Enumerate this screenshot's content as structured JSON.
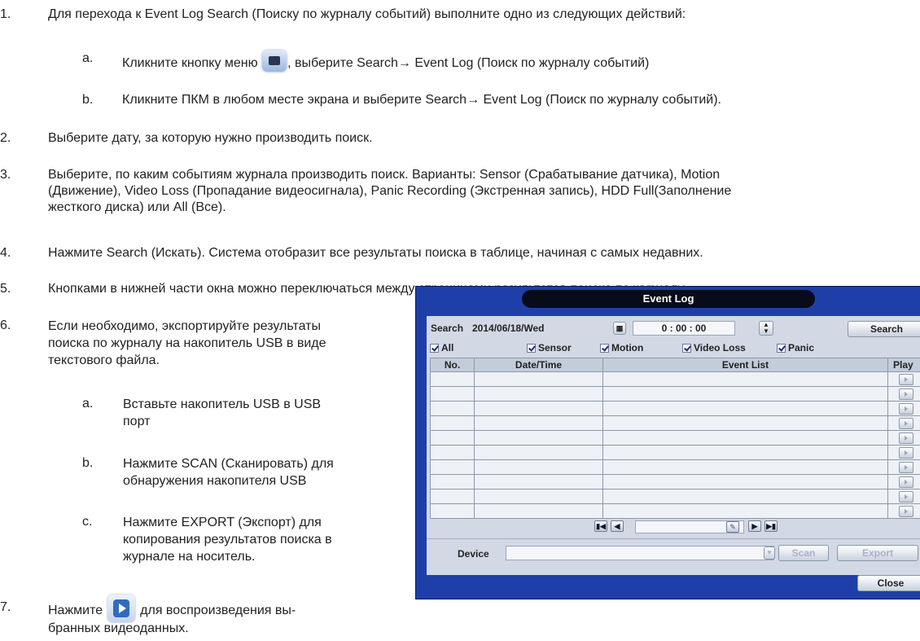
{
  "steps": [
    {
      "num": "1.",
      "text": "Для перехода к Event Log Search (Поиску по журналу событий) выполните одно из следующих действий:"
    },
    {
      "num": "2.",
      "text": "Выберите дату, за которую нужно производить поиск."
    },
    {
      "num": "3.",
      "lines": [
        "Выберите, по каким событиям журнала производить поиск. Варианты: Sensor (Срабатывание датчика), Motion",
        "(Движение), Video Loss (Пропадание видеосигнала), Panic Recording (Экстренная запись), HDD Full(Заполнение",
        "жесткого диска) или All (Все)."
      ]
    },
    {
      "num": "4.",
      "text": "Нажмите Search (Искать). Система отобразит все результаты поиска в таблице, начиная с самых недавних."
    },
    {
      "num": "5.",
      "text": "Кнопками в нижней части окна можно переключаться между страницами результатов поиска по журналу."
    },
    {
      "num": "6.",
      "lines": [
        "Если необходимо, экспортируйте результаты",
        "поиска по журналу на накопитель USB в виде",
        "текстового файла."
      ]
    },
    {
      "num": "7.",
      "before": "Нажмите",
      "after": "для воспроизведения вы-",
      "line2": "бранных видеоданных."
    }
  ],
  "substeps_1": [
    {
      "num": "a.",
      "before": "Кликните кнопку меню",
      "after": ", выберите Search→ Event Log (Поиск по журналу событий)"
    },
    {
      "num": "b.",
      "text": "Кликните ПКМ в любом месте экрана и выберите Search→ Event Log (Поиск по журналу событий)."
    }
  ],
  "substeps_6": [
    {
      "num": "a.",
      "lines": [
        "Вставьте накопитель USB в USB",
        "порт"
      ]
    },
    {
      "num": "b.",
      "lines": [
        "Нажмите SCAN (Сканировать) для",
        "обнаружения накопителя USB"
      ]
    },
    {
      "num": "c.",
      "lines": [
        "Нажмите EXPORT (Экспорт) для",
        "копирования результатов поиска в",
        "журнале на носитель."
      ]
    }
  ],
  "icons": {
    "menu": "menu-button-icon",
    "play": "play-button-icon"
  },
  "dialog": {
    "title": "Event Log",
    "search_label": "Search",
    "date": "2014/06/18/Wed",
    "time": "0 : 00 : 00",
    "search_button": "Search",
    "checkboxes": [
      "All",
      "Sensor",
      "Motion",
      "Video Loss",
      "Panic"
    ],
    "columns": [
      "No.",
      "Date/Time",
      "Event List",
      "Play"
    ],
    "device_label": "Device",
    "scan_button": "Scan",
    "export_button": "Export",
    "close_button": "Close",
    "colors": {
      "frame": "#1f3fa8",
      "panel": "#d2d9e4"
    }
  }
}
